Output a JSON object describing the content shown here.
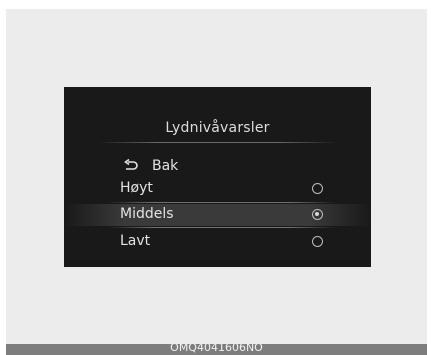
{
  "menu": {
    "title": "Lydnivåvarsler",
    "back_label": "Bak",
    "options": [
      {
        "label": "Høyt",
        "selected": false
      },
      {
        "label": "Middels",
        "selected": true
      },
      {
        "label": "Lavt",
        "selected": false
      }
    ]
  },
  "icons": {
    "back": "back-arrow-icon",
    "radio_off": "radio-empty-icon",
    "radio_on": "radio-selected-icon"
  },
  "colors": {
    "screen_background": "#191919",
    "text": "#e2e2e2",
    "selection_highlight": "#3a3a3a"
  },
  "footer": {
    "code": "OMQ4041606NO"
  }
}
